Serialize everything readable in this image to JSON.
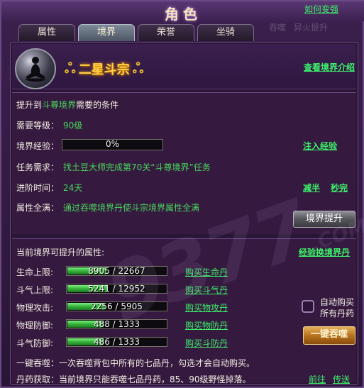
{
  "window": {
    "title": "角色",
    "help_link": "如何变强"
  },
  "background_text": [
    "吞噬",
    "异火提升"
  ],
  "tabs": [
    {
      "label": "属性",
      "active": false
    },
    {
      "label": "境界",
      "active": true
    },
    {
      "label": "荣誉",
      "active": false
    },
    {
      "label": "坐骑",
      "active": false
    }
  ],
  "realm": {
    "name": "二星斗宗",
    "view_intro_link": "查看境界介绍"
  },
  "upgrade": {
    "heading_prefix": "提升到",
    "heading_target": "斗尊境界",
    "heading_suffix": "需要的条件",
    "level_label": "需要等级：",
    "level_value": "90级",
    "exp_label": "境界经验：",
    "exp_percent": "0%",
    "exp_fill": 0,
    "inject_exp_link": "注入经验",
    "task_label": "任务需求：",
    "task_value": "找土豆大师完成第70关“斗尊境界”任务",
    "time_label": "进阶时间：",
    "time_value": "24天",
    "halve_link": "减半",
    "instant_link": "秒完",
    "full_attr_label": "属性全满：",
    "full_attr_value": "通过吞噬境界丹使斗宗境界属性全满",
    "upgrade_button": "境界提升"
  },
  "attributes": {
    "heading": "当前境界可提升的属性:",
    "exchange_link": "经验换境界丹",
    "rows": [
      {
        "label": "生命上限:",
        "current": 8905,
        "max": 22667,
        "text": "8905 / 22667",
        "buy": "购买生命丹"
      },
      {
        "label": "斗气上限:",
        "current": 5241,
        "max": 12952,
        "text": "5241 / 12952",
        "buy": "购买斗气丹"
      },
      {
        "label": "物理攻击:",
        "current": 2256,
        "max": 5905,
        "text": "2256 / 5905",
        "buy": "购买物攻丹"
      },
      {
        "label": "物理防御:",
        "current": 488,
        "max": 1333,
        "text": "488 / 1333",
        "buy": "购买物防丹"
      },
      {
        "label": "斗气防御:",
        "current": 486,
        "max": 1333,
        "text": "486 / 1333",
        "buy": "购买斗防丹"
      }
    ],
    "auto_buy_line1": "自动购买",
    "auto_buy_line2": "所有丹药",
    "devour_button": "一键吞噬",
    "note1_label": "一键吞噬：",
    "note1_text": "一次吞噬背包中所有的七品丹，勾选才会自动购买。",
    "note2_label": "丹药获取：",
    "note2_text": "当前境界只能吞噬七品丹药，85、90级野怪掉落。",
    "goto_link": "前往",
    "teleport_link": "传送"
  },
  "watermark": {
    "text": "9377",
    "suffix": ".COM"
  },
  "colors": {
    "accent_green": "#3df06a",
    "gold": "#ffd24a",
    "panel_bg": "#35193f"
  }
}
